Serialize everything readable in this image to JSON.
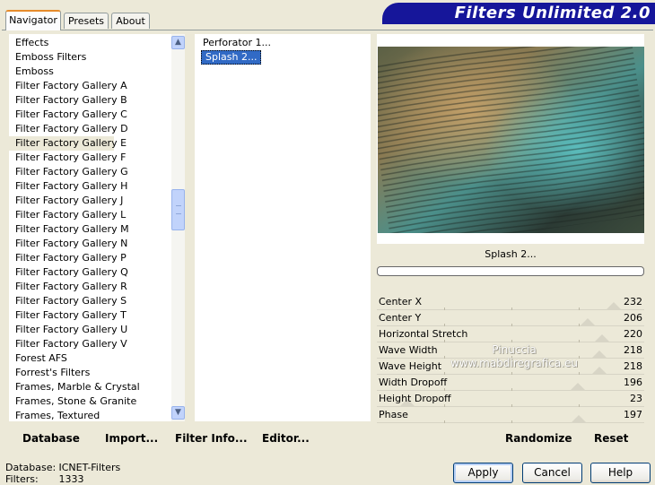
{
  "tabs": [
    {
      "label": "Navigator"
    },
    {
      "label": "Presets"
    },
    {
      "label": "About"
    }
  ],
  "app_title": "Filters Unlimited 2.0",
  "categories": [
    "Effects",
    "Emboss Filters",
    "Emboss",
    "Filter Factory Gallery A",
    "Filter Factory Gallery B",
    "Filter Factory Gallery C",
    "Filter Factory Gallery D",
    "Filter Factory Gallery E",
    "Filter Factory Gallery F",
    "Filter Factory Gallery G",
    "Filter Factory Gallery H",
    "Filter Factory Gallery J",
    "Filter Factory Gallery L",
    "Filter Factory Gallery M",
    "Filter Factory Gallery N",
    "Filter Factory Gallery P",
    "Filter Factory Gallery Q",
    "Filter Factory Gallery R",
    "Filter Factory Gallery S",
    "Filter Factory Gallery T",
    "Filter Factory Gallery U",
    "Filter Factory Gallery V",
    "Forest AFS",
    "Forrest's Filters",
    "Frames, Marble & Crystal",
    "Frames, Stone & Granite",
    "Frames, Textured"
  ],
  "selected_category": "Filter Factory Gallery E",
  "filters": [
    "Perforator 1...",
    "Splash 2..."
  ],
  "selected_filter": "Splash 2...",
  "preview": {
    "filter_name": "Splash 2...",
    "watermark_line1": "Pinuccia",
    "watermark_line2": "www.mabdiregrafica.eu"
  },
  "params": [
    {
      "label": "Center X",
      "value": "232"
    },
    {
      "label": "Center Y",
      "value": "206"
    },
    {
      "label": "Horizontal Stretch",
      "value": "220"
    },
    {
      "label": "Wave Width",
      "value": "218"
    },
    {
      "label": "Wave Height",
      "value": "218"
    },
    {
      "label": "Width Dropoff",
      "value": "196"
    },
    {
      "label": "Height Dropoff",
      "value": "23"
    },
    {
      "label": "Phase",
      "value": "197"
    }
  ],
  "toolbar": {
    "database": "Database",
    "import": "Import...",
    "filter_info": "Filter Info...",
    "editor": "Editor...",
    "randomize": "Randomize",
    "reset": "Reset"
  },
  "status": {
    "database_label": "Database:",
    "database_value": "ICNET-Filters",
    "filters_label": "Filters:",
    "filters_value": "1333"
  },
  "buttons": {
    "apply": "Apply",
    "cancel": "Cancel",
    "help": "Help"
  }
}
